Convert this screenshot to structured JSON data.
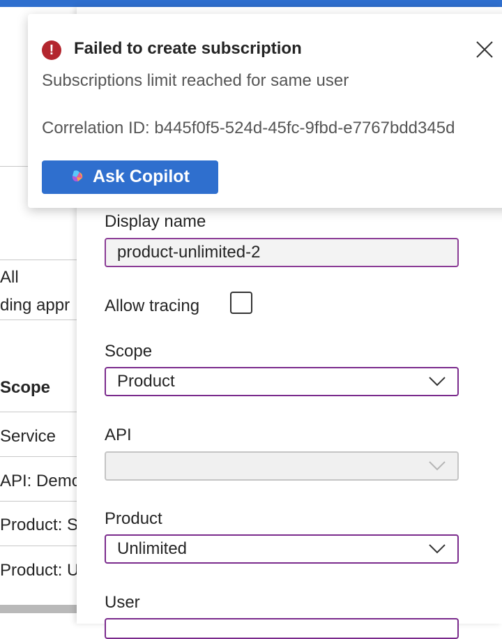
{
  "toast": {
    "title": "Failed to create subscription",
    "message": "Subscriptions limit reached for same user",
    "correlation": "Correlation ID: b445f0f5-524d-45fc-9fbd-e7767bdd345d",
    "button_label": "Ask Copilot",
    "error_icon": "!"
  },
  "left": {
    "filter_value": "All",
    "filter_value2": "ding appr",
    "column_header": "Scope",
    "rows": [
      "Service",
      "API: Demo",
      "Product: St",
      "Product: U"
    ]
  },
  "form": {
    "display_name_label": "Display name",
    "display_name_value": "product-unlimited-2",
    "allow_tracing_label": "Allow tracing",
    "allow_tracing_checked": false,
    "scope_label": "Scope",
    "scope_value": "Product",
    "api_label": "API",
    "api_value": "",
    "product_label": "Product",
    "product_value": "Unlimited",
    "user_label": "User"
  },
  "colors": {
    "accent": "#2f6fce",
    "field_border": "#7a2a8c",
    "error": "#b3262e"
  },
  "icons": [
    "error-icon",
    "close-icon",
    "copilot-icon",
    "chevron-down-icon"
  ]
}
